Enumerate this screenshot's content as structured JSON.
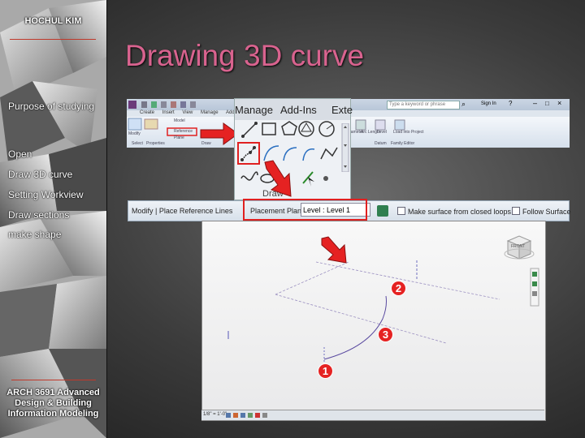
{
  "slide": {
    "author": "HOCHUL KIM",
    "title": "Drawing 3D curve",
    "course": "ARCH 3691 Advanced Design & Building Information Modeling"
  },
  "sidebar": {
    "items": [
      {
        "label": "Purpose of studying",
        "active": false
      },
      {
        "label": "Open",
        "active": false
      },
      {
        "label": "Draw 3D curve",
        "active": true
      },
      {
        "label": "Setting Workview",
        "active": false
      },
      {
        "label": "Draw sections",
        "active": false
      },
      {
        "label": "make shape",
        "active": false
      }
    ]
  },
  "ribbon": {
    "search_placeholder": "Type a keyword or phrase",
    "sign_in": "Sign In",
    "tabs": [
      "Create",
      "Insert",
      "View",
      "Manage",
      "Add-Ins"
    ],
    "buttons": {
      "modify": "Modify",
      "model": "Model",
      "reference": "Reference",
      "plane": "Plane",
      "parameter": "Parameter",
      "arc_length": "Arc Length",
      "level": "Level",
      "load_into_project": "Load into Project"
    },
    "panels": [
      "Select",
      "Properties",
      "Draw",
      "Datum",
      "Family Editor"
    ]
  },
  "draw_panel": {
    "tabs": [
      "Manage",
      "Add-Ins",
      "Exte"
    ],
    "label": "Draw"
  },
  "options_bar": {
    "context": "Modify | Place Reference Lines",
    "placement_label": "Placement Plane:",
    "placement_value": "Level : Level 1",
    "make_surface": "Make surface from closed loops",
    "follow_surface": "Follow Surface"
  },
  "viewport": {
    "view_cube_label": "FRONT",
    "status_text": "1/8\" = 1'-0\""
  },
  "steps": [
    "1",
    "2",
    "3"
  ],
  "colors": {
    "title": "#d9638f",
    "highlight": "#e02020",
    "step_badge": "#e52222"
  }
}
